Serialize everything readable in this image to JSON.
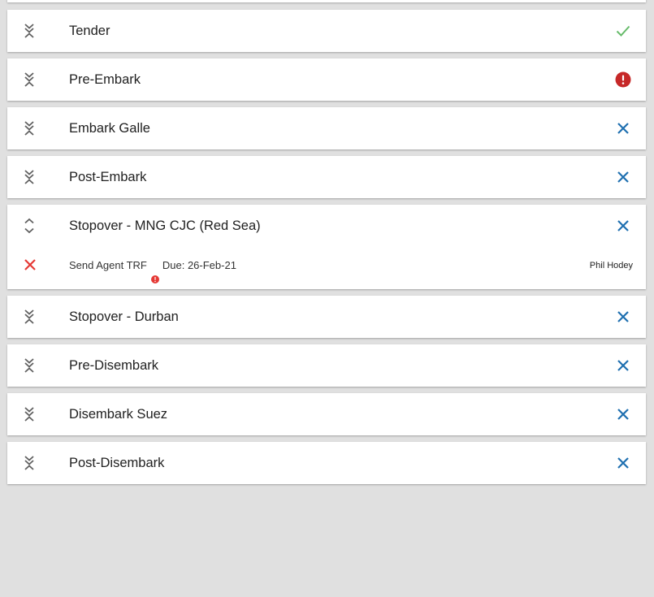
{
  "colors": {
    "background": "#e0e0e0",
    "card": "#ffffff",
    "check_green": "#66bb6a",
    "alert_red": "#c62828",
    "close_blue": "#1e6fb0",
    "task_fail_red": "#e53935"
  },
  "stages": [
    {
      "title": "Tender",
      "status": "complete",
      "status_icon": "check-icon"
    },
    {
      "title": "Pre-Embark",
      "status": "alert",
      "status_icon": "alert-circle-icon"
    },
    {
      "title": "Embark Galle",
      "status": "closed",
      "status_icon": "close-icon"
    },
    {
      "title": "Post-Embark",
      "status": "closed",
      "status_icon": "close-icon"
    },
    {
      "title": "Stopover - MNG CJC (Red Sea)",
      "status": "closed",
      "status_icon": "close-icon",
      "expanded": true,
      "tasks": [
        {
          "name": "Send Agent TRF",
          "due": "Due: 26-Feb-21",
          "assignee": "Phil Hodey",
          "status_icon": "close-icon",
          "alert_icon": "alert-circle-icon"
        }
      ]
    },
    {
      "title": "Stopover - Durban",
      "status": "closed",
      "status_icon": "close-icon"
    },
    {
      "title": "Pre-Disembark",
      "status": "closed",
      "status_icon": "close-icon"
    },
    {
      "title": "Disembark Suez",
      "status": "closed",
      "status_icon": "close-icon"
    },
    {
      "title": "Post-Disembark",
      "status": "closed",
      "status_icon": "close-icon"
    }
  ]
}
